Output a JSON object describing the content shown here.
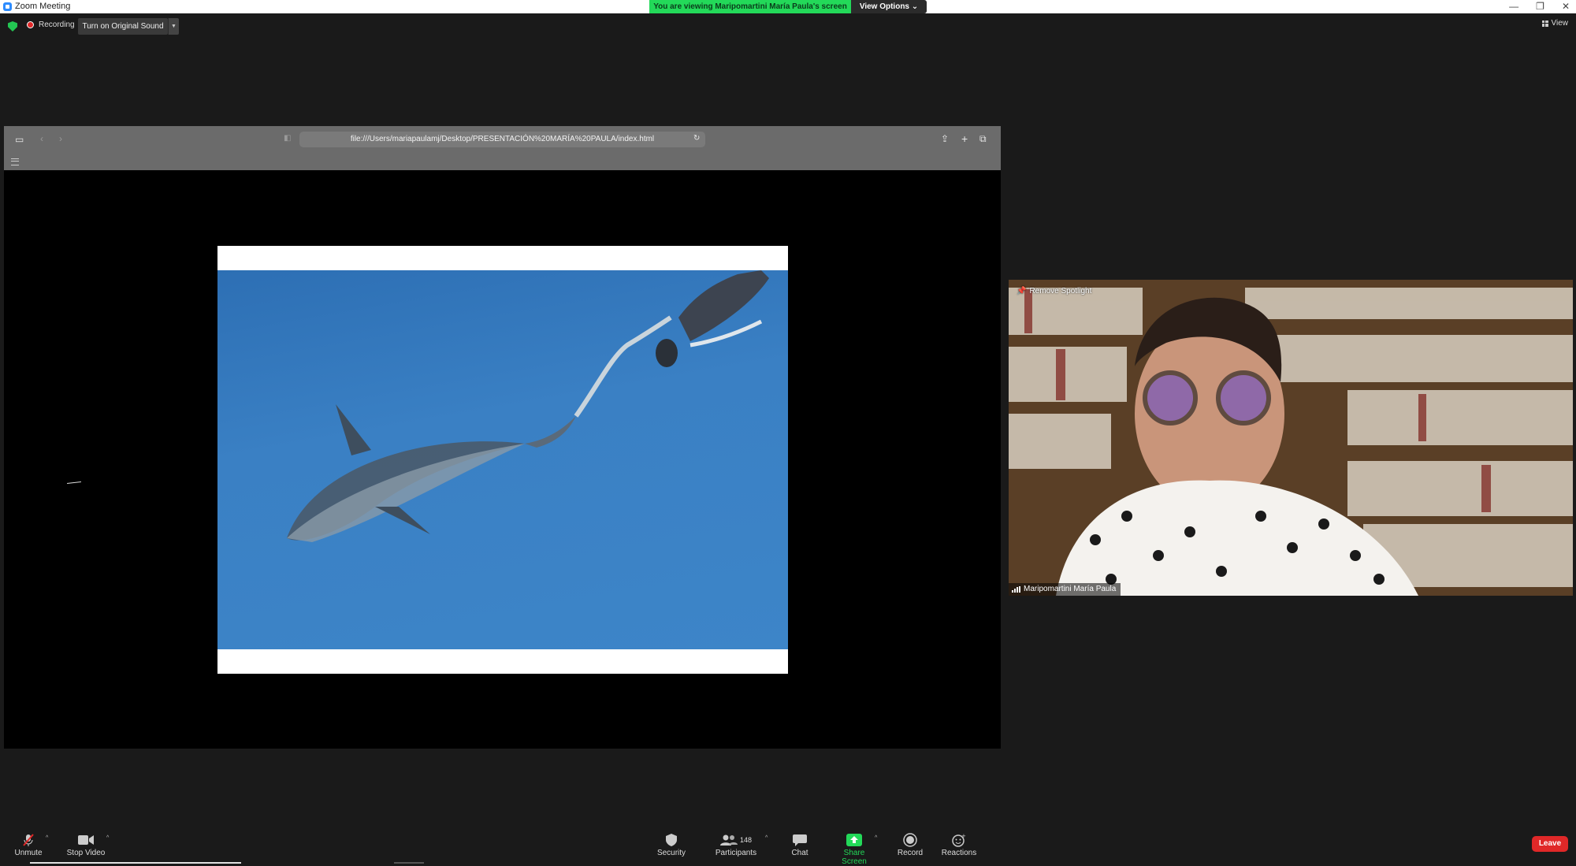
{
  "window": {
    "title": "Zoom Meeting",
    "viewing_banner": "You are viewing Maripomartini María Paula's screen",
    "view_options_label": "View Options",
    "controls": [
      "—",
      "❐",
      "✕"
    ]
  },
  "top_bar": {
    "recording_label": "Recording",
    "original_sound_label": "Turn on Original Sound",
    "view_label": "View"
  },
  "shared_screen": {
    "url": "file:///Users/mariapaulamj/Desktop/PRESENTACIÓN%20MARÍA%20PAULA/index.html"
  },
  "video": {
    "spotlight_label": "Remove Spotlight",
    "participant_name": "Maripomartini María Paula"
  },
  "toolbar": {
    "unmute_label": "Unmute",
    "stop_video_label": "Stop Video",
    "security_label": "Security",
    "participants_label": "Participants",
    "participants_count": "148",
    "chat_label": "Chat",
    "share_screen_label": "Share Screen",
    "record_label": "Record",
    "reactions_label": "Reactions",
    "leave_label": "Leave"
  },
  "colors": {
    "banner": "#23d959",
    "share_screen": "#23d959",
    "leave": "#e02828",
    "recording_dot": "#e02828"
  }
}
